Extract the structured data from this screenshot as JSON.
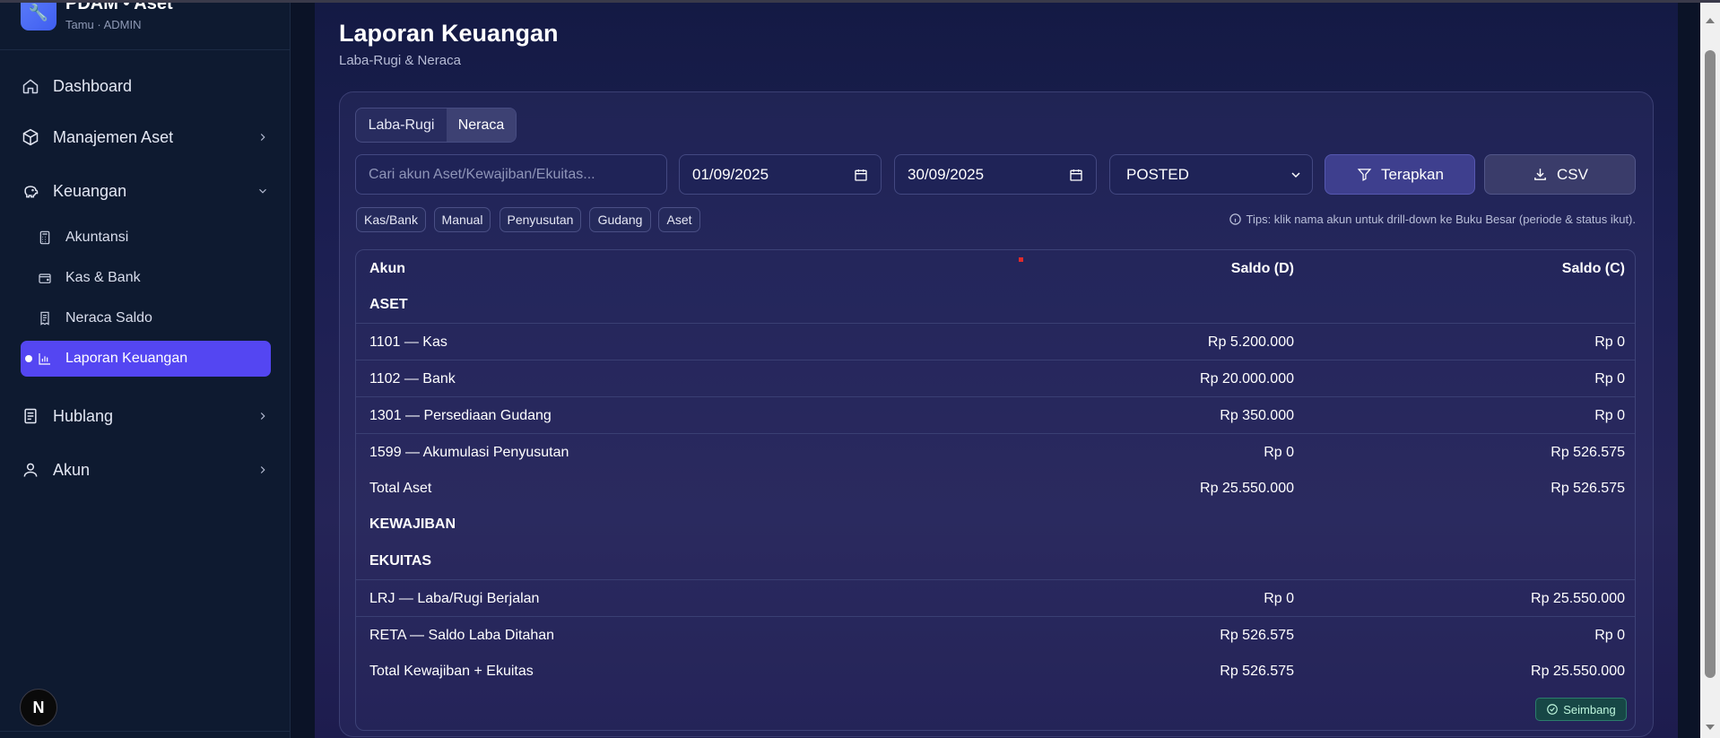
{
  "brand": {
    "logo_glyph": "🔧",
    "title": "PDAM • Aset",
    "subtitle": "Tamu · ADMIN"
  },
  "sidebar": {
    "items": [
      {
        "label": "Dashboard",
        "icon": "home-icon"
      },
      {
        "label": "Manajemen Aset",
        "icon": "box-icon"
      },
      {
        "label": "Keuangan",
        "icon": "piggy-bank-icon"
      },
      {
        "label": "Hublang",
        "icon": "document-icon"
      },
      {
        "label": "Akun",
        "icon": "user-icon"
      }
    ],
    "keuangan_sub": [
      {
        "label": "Akuntansi",
        "icon": "calculator-icon"
      },
      {
        "label": "Kas & Bank",
        "icon": "wallet-icon"
      },
      {
        "label": "Neraca Saldo",
        "icon": "receipt-icon"
      },
      {
        "label": "Laporan Keuangan",
        "icon": "bar-chart-icon",
        "active": true
      }
    ],
    "avatar_letter": "N"
  },
  "page": {
    "title": "Laporan Keuangan",
    "subtitle": "Laba-Rugi & Neraca"
  },
  "tabs": [
    {
      "label": "Laba-Rugi"
    },
    {
      "label": "Neraca",
      "active": true
    }
  ],
  "filters": {
    "search_placeholder": "Cari akun Aset/Kewajiban/Ekuitas...",
    "date_from": "01/09/2025",
    "date_to": "30/09/2025",
    "status": "POSTED",
    "apply_label": "Terapkan",
    "csv_label": "CSV"
  },
  "chips": [
    "Kas/Bank",
    "Manual",
    "Penyusutan",
    "Gudang",
    "Aset"
  ],
  "tip": "Tips: klik nama akun untuk drill-down ke Buku Besar (periode & status ikut).",
  "table": {
    "headers": {
      "account": "Akun",
      "debit": "Saldo (D)",
      "credit": "Saldo (C)"
    },
    "rows": [
      {
        "type": "section",
        "account": "ASET",
        "debit": "",
        "credit": ""
      },
      {
        "type": "row",
        "account": "1101 — Kas",
        "debit": "Rp 5.200.000",
        "credit": "Rp 0"
      },
      {
        "type": "row",
        "account": "1102 — Bank",
        "debit": "Rp 20.000.000",
        "credit": "Rp 0"
      },
      {
        "type": "row",
        "account": "1301 — Persediaan Gudang",
        "debit": "Rp 350.000",
        "credit": "Rp 0"
      },
      {
        "type": "row",
        "account": "1599 — Akumulasi Penyusutan",
        "debit": "Rp 0",
        "credit": "Rp 526.575"
      },
      {
        "type": "total",
        "account": "Total Aset",
        "debit": "Rp 25.550.000",
        "credit": "Rp 526.575"
      },
      {
        "type": "section",
        "account": "KEWAJIBAN",
        "debit": "",
        "credit": ""
      },
      {
        "type": "section",
        "account": "EKUITAS",
        "debit": "",
        "credit": ""
      },
      {
        "type": "row",
        "account": "LRJ — Laba/Rugi Berjalan",
        "debit": "Rp 0",
        "credit": "Rp 25.550.000"
      },
      {
        "type": "row",
        "account": "RETA — Saldo Laba Ditahan",
        "debit": "Rp 526.575",
        "credit": "Rp 0"
      },
      {
        "type": "total",
        "account": "Total Kewajiban + Ekuitas",
        "debit": "Rp 526.575",
        "credit": "Rp 25.550.000"
      }
    ],
    "balance_badge": "Seimbang"
  }
}
